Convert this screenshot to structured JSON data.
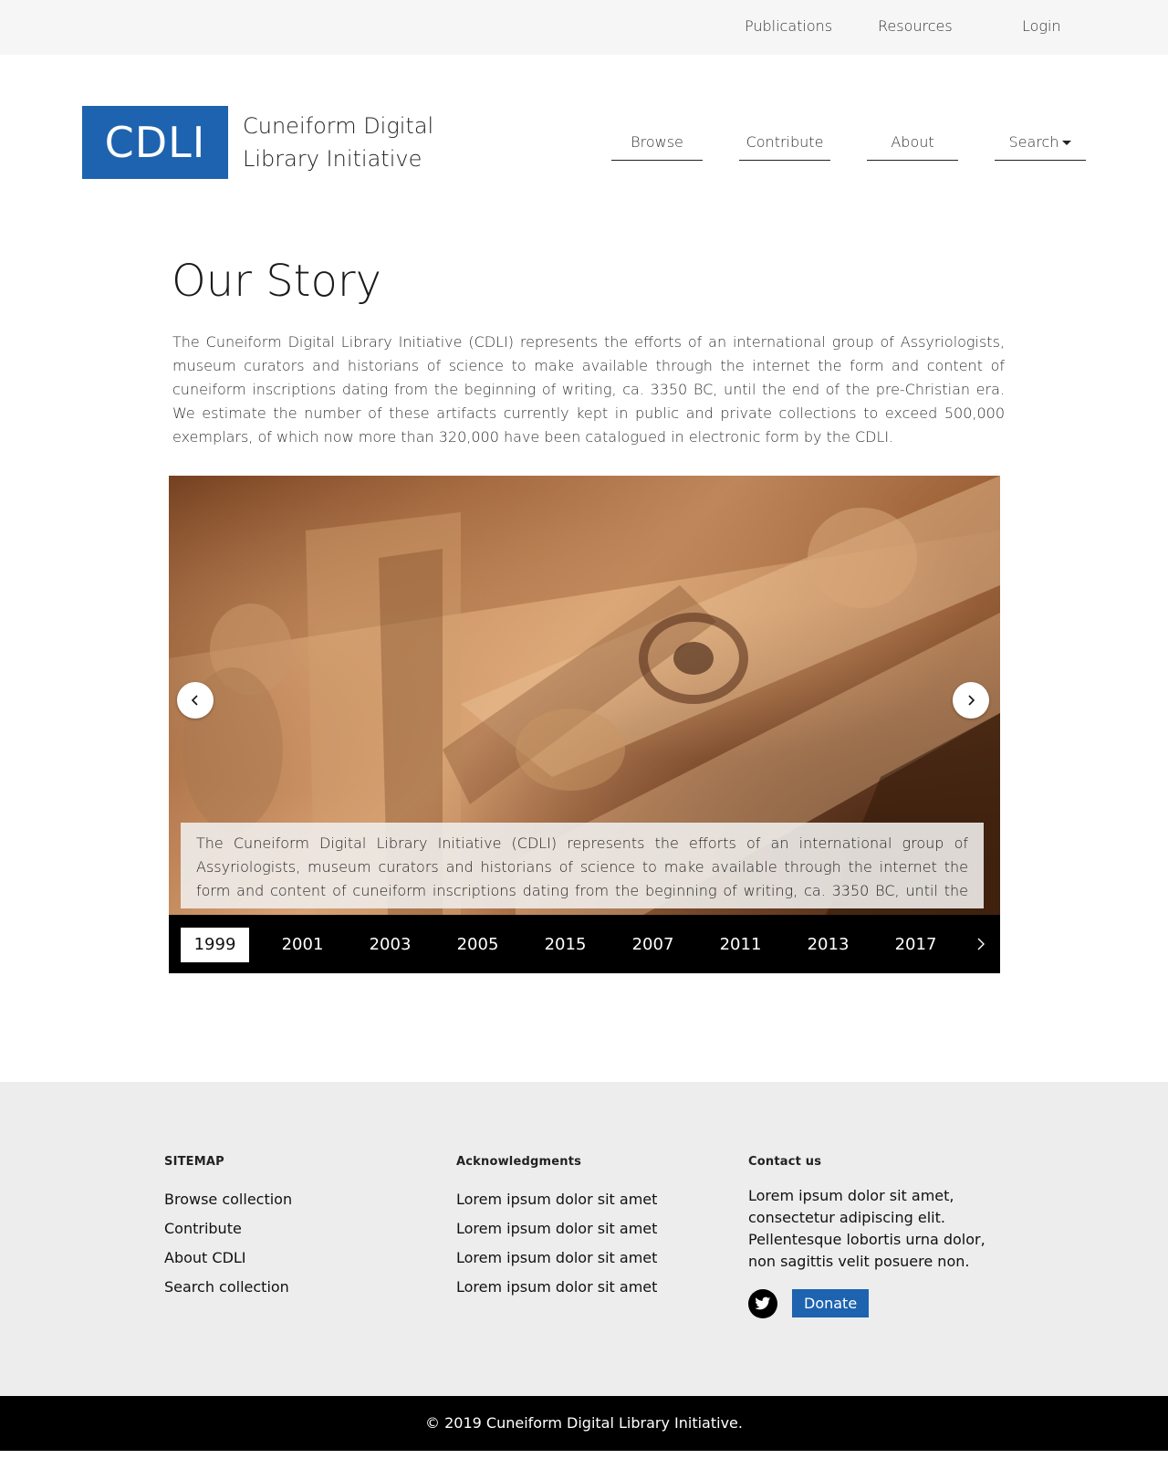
{
  "topbar": {
    "publications": "Publications",
    "resources": "Resources",
    "login": "Login"
  },
  "header": {
    "logo": "CDLI",
    "site_name": "Cuneiform Digital Library Initiative"
  },
  "nav": {
    "browse": "Browse",
    "contribute": "Contribute",
    "about": "About",
    "search": "Search"
  },
  "story": {
    "title": "Our Story",
    "text": "The Cuneiform Digital Library Initiative (CDLI) represents the efforts of an international group of Assyriologists, museum curators and historians of science to make available through the internet the form and content of cuneiform inscriptions dating from the beginning of writing, ca. 3350 BC, until the end of the pre-Christian era. We estimate the number of these artifacts currently kept in public and private collections to exceed 500,000 exemplars, of which now more than 320,000 have been catalogued in electronic form by the CDLI."
  },
  "carousel": {
    "caption": "The Cuneiform Digital Library Initiative (CDLI) represents the efforts of an international group of Assyriologists, museum curators and historians of science to make available through the internet the form and content of cuneiform inscriptions dating from the beginning of writing, ca. 3350 BC, until the end of the pre-Christian era. We estimate the",
    "years": [
      "1999",
      "2001",
      "2003",
      "2005",
      "2015",
      "2007",
      "2011",
      "2013",
      "2017"
    ],
    "active_year": "1999"
  },
  "footer": {
    "sitemap": {
      "heading": "SITEMAP",
      "links": [
        "Browse collection",
        "Contribute",
        "About CDLI",
        "Search collection"
      ]
    },
    "acknowledgments": {
      "heading": "Acknowledgments",
      "links": [
        "Lorem ipsum dolor sit amet",
        "Lorem ipsum dolor sit amet",
        "Lorem ipsum dolor sit amet",
        "Lorem ipsum dolor sit amet"
      ]
    },
    "contact": {
      "heading": "Contact us",
      "text": "Lorem ipsum dolor sit amet, consectetur adipiscing elit. Pellentesque lobortis urna dolor, non sagittis velit posuere non.",
      "donate": "Donate"
    },
    "copyright": "© 2019 Cuneiform Digital Library Initiative."
  },
  "colors": {
    "brand_blue": "#1d63b0",
    "topbar_bg": "#f6f6f6",
    "footer_bg": "#ededed"
  }
}
